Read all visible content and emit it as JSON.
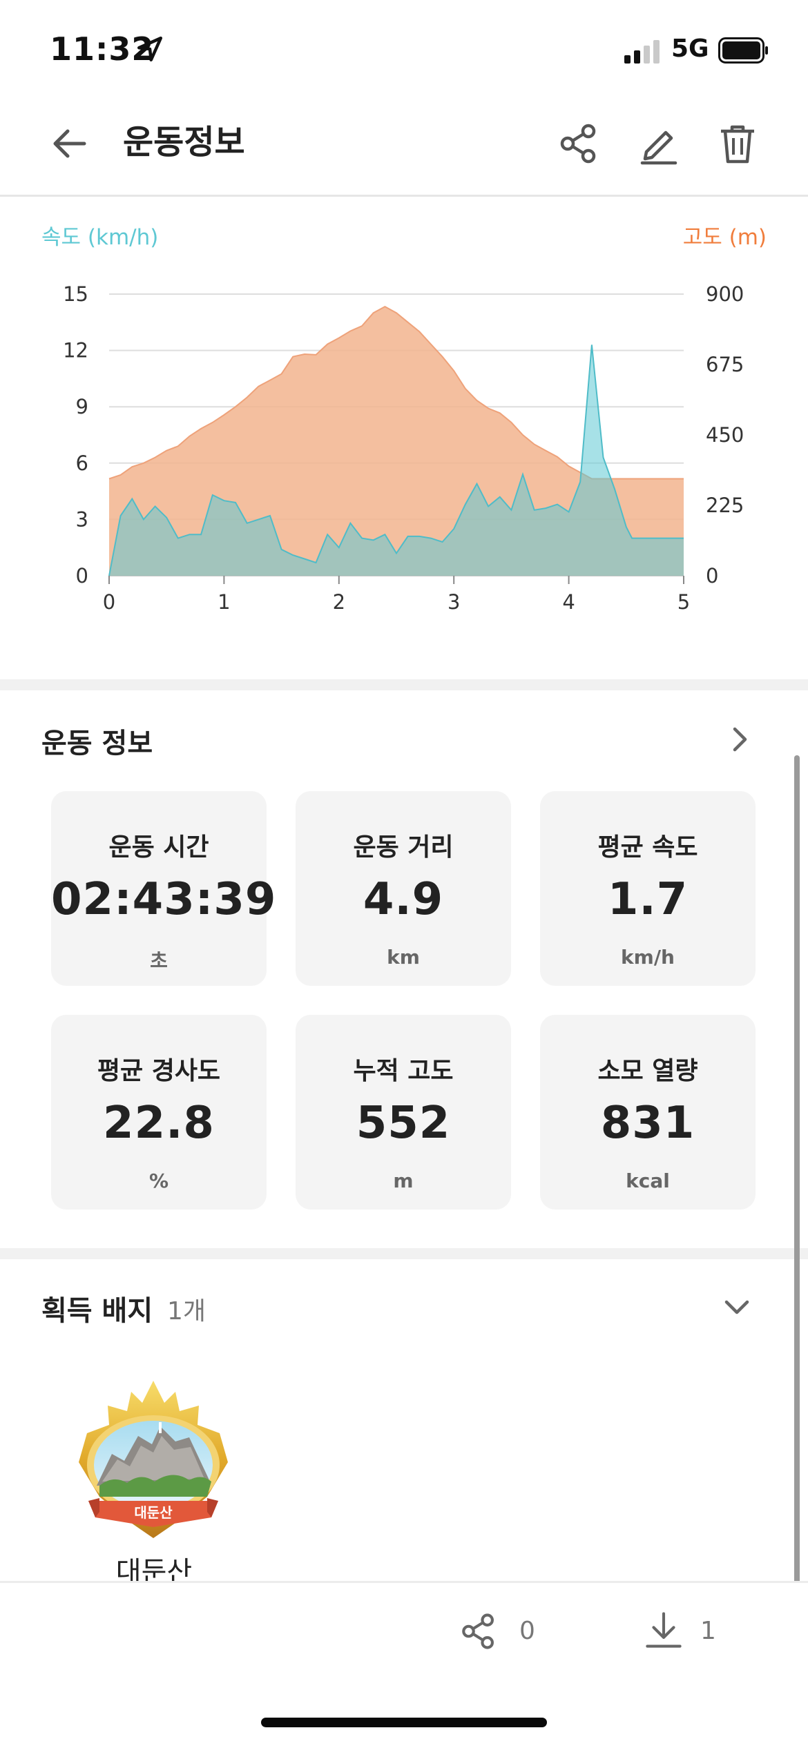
{
  "status_bar": {
    "time": "11:32",
    "network": "5G"
  },
  "header": {
    "title": "운동정보",
    "icons": [
      "back-arrow-icon",
      "share-icon",
      "edit-icon",
      "trash-icon"
    ]
  },
  "colors": {
    "speed": "#5ec8d3",
    "altitude": "#f2b48e",
    "altitude_label": "#f07d3c",
    "overlap": "#c2b69a"
  },
  "chart_labels": {
    "left_axis": "속도 (km/h)",
    "right_axis": "고도 (m)"
  },
  "chart_data": {
    "type": "area",
    "x": [
      0,
      0.1,
      0.2,
      0.3,
      0.4,
      0.5,
      0.6,
      0.7,
      0.8,
      0.9,
      1.0,
      1.1,
      1.2,
      1.3,
      1.4,
      1.5,
      1.6,
      1.7,
      1.8,
      1.9,
      2.0,
      2.1,
      2.2,
      2.3,
      2.4,
      2.5,
      2.6,
      2.7,
      2.8,
      2.9,
      3.0,
      3.1,
      3.2,
      3.3,
      3.4,
      3.5,
      3.6,
      3.7,
      3.8,
      3.9,
      4.0,
      4.1,
      4.2,
      4.3,
      4.4,
      4.5,
      4.55,
      4.6,
      4.7,
      4.8,
      4.9,
      5.0
    ],
    "series": [
      {
        "name": "속도 (km/h)",
        "axis": "left",
        "values": [
          0,
          3.2,
          4.1,
          3.0,
          3.7,
          3.1,
          2.0,
          2.2,
          2.2,
          4.3,
          4.0,
          3.9,
          2.8,
          3.0,
          3.2,
          1.4,
          1.1,
          0.9,
          0.7,
          2.2,
          1.5,
          2.8,
          2.0,
          1.9,
          2.2,
          1.2,
          2.1,
          2.1,
          2.0,
          1.8,
          2.5,
          3.8,
          4.9,
          3.7,
          4.2,
          3.5,
          5.4,
          3.5,
          3.6,
          3.8,
          3.4,
          5.0,
          12.3,
          6.3,
          4.6,
          2.6,
          2.0,
          2.0,
          2.0,
          2.0,
          2.0,
          2.0
        ]
      },
      {
        "name": "고도 (m)",
        "axis": "right",
        "values": [
          310,
          322,
          348,
          360,
          378,
          400,
          414,
          446,
          470,
          490,
          514,
          540,
          570,
          605,
          625,
          645,
          700,
          708,
          706,
          740,
          760,
          782,
          798,
          840,
          860,
          840,
          810,
          780,
          740,
          700,
          655,
          598,
          560,
          535,
          520,
          490,
          450,
          420,
          400,
          380,
          350,
          330,
          310,
          310,
          310,
          310,
          310,
          310,
          310,
          310,
          310,
          310
        ]
      }
    ],
    "x_ticks": [
      "0",
      "1",
      "2",
      "3",
      "4",
      "5"
    ],
    "y_left_ticks": [
      "0",
      "3",
      "6",
      "9",
      "12",
      "15"
    ],
    "y_right_ticks": [
      "0",
      "225",
      "450",
      "675",
      "900"
    ],
    "xlim": [
      0,
      5
    ],
    "ylim_left": [
      0,
      15
    ],
    "ylim_right": [
      0,
      900
    ],
    "grid": true
  },
  "workout_section": {
    "title": "운동 정보",
    "stats": [
      {
        "label": "운동 시간",
        "value": "02:43:39",
        "unit": "초"
      },
      {
        "label": "운동 거리",
        "value": "4.9",
        "unit": "km"
      },
      {
        "label": "평균 속도",
        "value": "1.7",
        "unit": "km/h"
      },
      {
        "label": "평균 경사도",
        "value": "22.8",
        "unit": "%"
      },
      {
        "label": "누적 고도",
        "value": "552",
        "unit": "m"
      },
      {
        "label": "소모 열량",
        "value": "831",
        "unit": "kcal"
      }
    ]
  },
  "badge_section": {
    "title": "획득 배지",
    "count": "1개",
    "badges": [
      {
        "name": "대둔산",
        "ribbon_text": "대둔산"
      }
    ]
  },
  "bottom_bar": {
    "share_count": "0",
    "download_count": "1"
  }
}
